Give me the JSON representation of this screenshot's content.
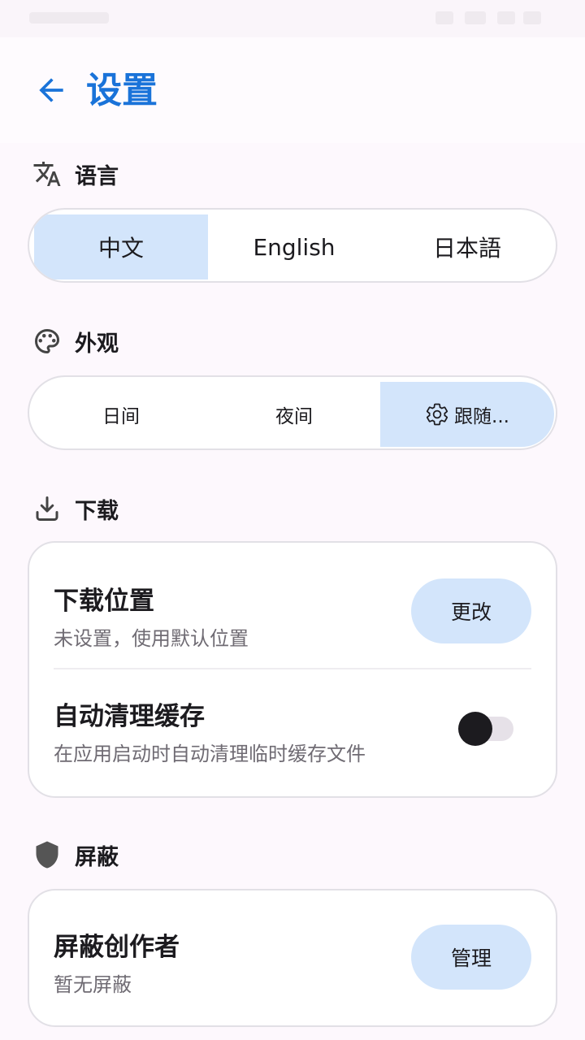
{
  "header": {
    "title": "设置"
  },
  "language": {
    "heading": "语言",
    "options": [
      "中文",
      "English",
      "日本語"
    ],
    "selected": "中文"
  },
  "appearance": {
    "heading": "外观",
    "options": [
      "日间",
      "夜间",
      "跟随..."
    ],
    "selected": "跟随..."
  },
  "download": {
    "heading": "下载",
    "location_title": "下载位置",
    "location_sub": "未设置，使用默认位置",
    "change_label": "更改",
    "autoclean_title": "自动清理缓存",
    "autoclean_sub": "在应用启动时自动清理临时缓存文件",
    "autoclean_enabled": false
  },
  "block": {
    "heading": "屏蔽",
    "creators_title": "屏蔽创作者",
    "creators_sub": "暂无屏蔽",
    "manage_label": "管理"
  },
  "colors": {
    "accent": "#1a73d9",
    "selected_bg": "#d3e5fb",
    "background": "#fdf8fd"
  }
}
